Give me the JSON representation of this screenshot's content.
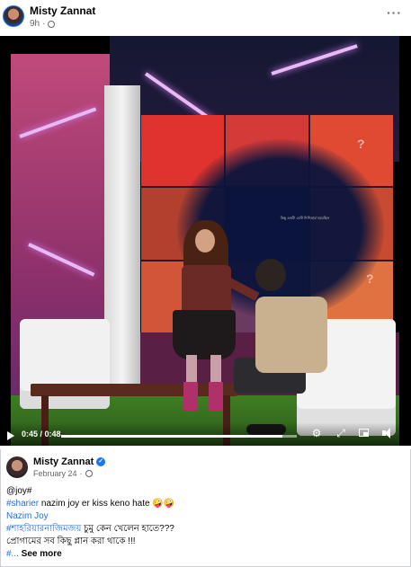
{
  "post": {
    "author": "Misty Zannat",
    "time": "9h",
    "more": "···"
  },
  "video": {
    "current_time": "0:45",
    "total_time": "0:48",
    "progress": 0.9375,
    "studio_caption": "কিছু একটা বেস্ট নিশিতারা হয়েছিল",
    "icons": [
      "play-icon",
      "settings-gear-icon",
      "expand-icon",
      "picture-in-picture-icon",
      "volume-icon"
    ]
  },
  "shared": {
    "author": "Misty Zannat",
    "date": "February 24",
    "lines": {
      "l1": "@joy#",
      "l2_tag": "#sharier",
      "l2_text": " nazim joy er kiss keno hate 🤪🤪",
      "l3": "Nazim Joy",
      "l4_tag": "#শাহরিয়ারনাজিমজয়",
      "l4_text": " চুমু কেন খেলেন হাতে???",
      "l5": "প্রোগামের সব কিছু প্লান করা থাকে !!!",
      "l6_tag": "#...",
      "l6_more": " See more"
    }
  },
  "colors": {
    "link": "#216fdb",
    "verified": "#1877f2",
    "muted": "#65676b"
  }
}
